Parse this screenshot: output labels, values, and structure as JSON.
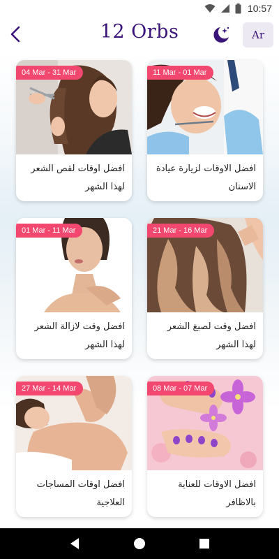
{
  "status_bar": {
    "time": "10:57"
  },
  "header": {
    "title": "12 Orbs",
    "language_button": "Ar"
  },
  "cards": [
    {
      "date_range": "04 Mar - 31 Mar",
      "title": "افضل اوقات لقص الشعر لهذا الشهر",
      "image": "hair-cut-photo"
    },
    {
      "date_range": "11 Mar - 01 Mar",
      "title": "افضل الاوقات لزيارة عيادة الاسنان",
      "image": "dentist-visit-photo"
    },
    {
      "date_range": "01 Mar - 11 Mar",
      "title": "افضل وقت لازالة الشعر لهذا الشهر",
      "image": "hair-removal-photo"
    },
    {
      "date_range": "21 Mar - 16 Mar",
      "title": "افضل وقت لصبغ الشعر لهذا الشهر",
      "image": "hair-dye-photo"
    },
    {
      "date_range": "27 Mar - 14 Mar",
      "title": "افضل اوقات المساجات العلاجية",
      "image": "massage-photo"
    },
    {
      "date_range": "08 Mar - 07 Mar",
      "title": "افضل الاوقات للعناية بالاظافر",
      "image": "nail-care-photo"
    }
  ],
  "colors": {
    "title": "#3a1478",
    "badge": "#f2476f",
    "language_button_bg": "#ece9f3"
  }
}
